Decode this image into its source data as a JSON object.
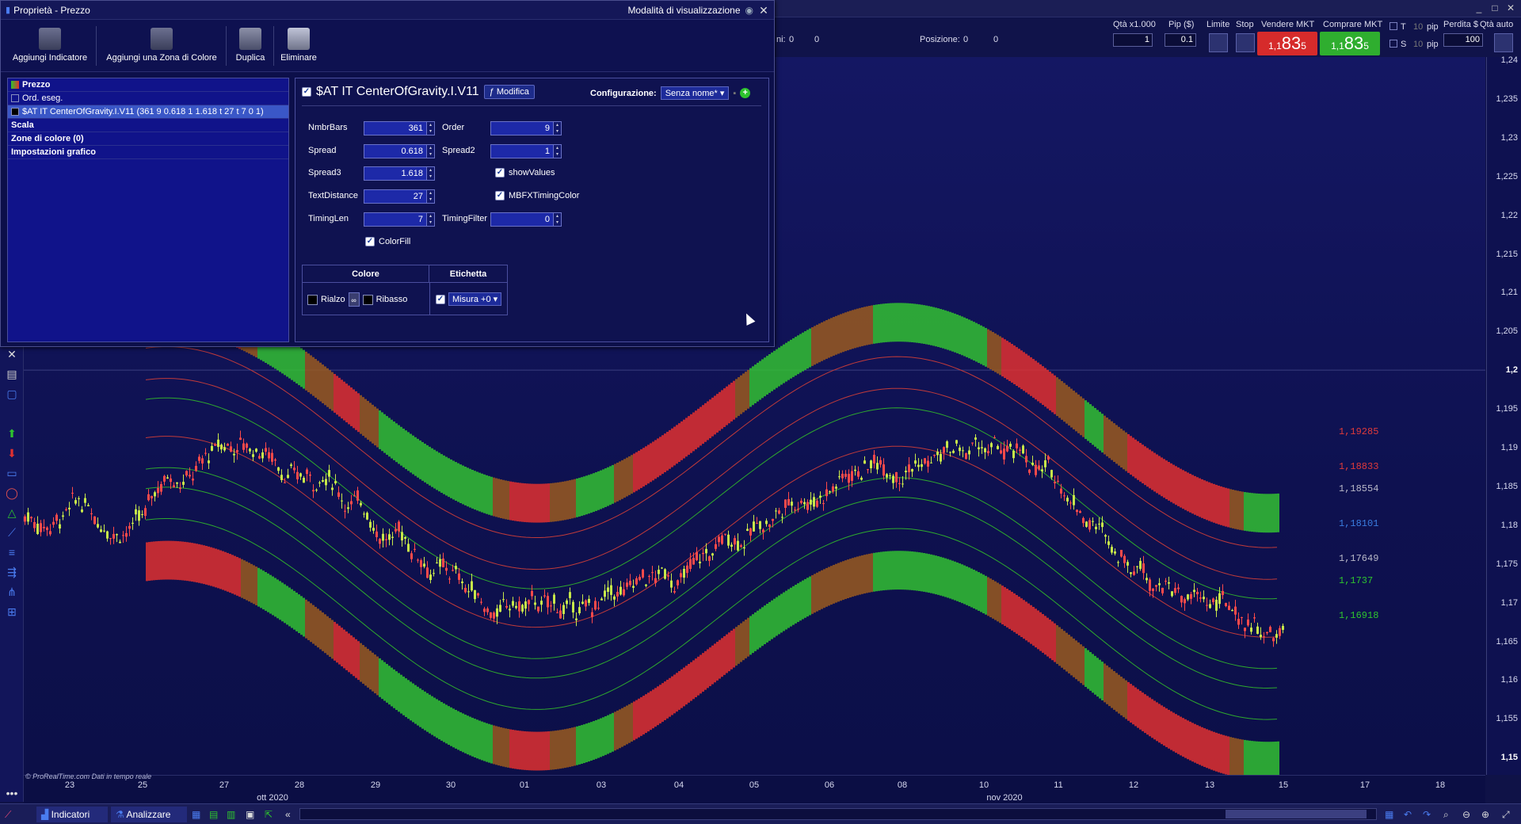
{
  "dialog": {
    "title": "Proprietà - Prezzo",
    "view_mode": "Modalità di visualizzazione",
    "toolbar": [
      {
        "label": "Aggiungi Indicatore",
        "icon": "add-indicator-icon"
      },
      {
        "label": "Aggiungi una Zona di Colore",
        "icon": "add-color-zone-icon"
      },
      {
        "label": "Duplica",
        "icon": "duplicate-icon"
      },
      {
        "label": "Eliminare",
        "icon": "trash-icon"
      }
    ],
    "tree": [
      {
        "label": "Prezzo",
        "bold": true
      },
      {
        "label": "Ord. eseg.",
        "bold": false
      },
      {
        "label": "$AT IT CenterOfGravity.I.V11 (361 9 0.618 1 1.618 t 27 t 7 0 1)",
        "selected": true
      },
      {
        "label": "Scala",
        "bold": true
      },
      {
        "label": "Zone di colore (0)",
        "bold": true
      },
      {
        "label": "Impostazioni grafico",
        "bold": true
      }
    ],
    "indicator_name": "$AT IT CenterOfGravity.I.V11",
    "modify_label": "Modifica",
    "config_label": "Configurazione:",
    "config_value": "Senza nome*",
    "params": {
      "NmbrBars": {
        "label": "NmbrBars",
        "value": "361"
      },
      "Order": {
        "label": "Order",
        "value": "9"
      },
      "Spread": {
        "label": "Spread",
        "value": "0.618"
      },
      "Spread2": {
        "label": "Spread2",
        "value": "1"
      },
      "Spread3": {
        "label": "Spread3",
        "value": "1.618"
      },
      "showValues": {
        "label": "showValues",
        "checked": true
      },
      "TextDistance": {
        "label": "TextDistance",
        "value": "27"
      },
      "MBFXTimingColor": {
        "label": "MBFXTimingColor",
        "checked": true
      },
      "TimingLen": {
        "label": "TimingLen",
        "value": "7"
      },
      "TimingFilter": {
        "label": "TimingFilter",
        "value": "0"
      },
      "ColorFill": {
        "label": "ColorFill",
        "checked": true
      }
    },
    "table": {
      "col_color": "Colore",
      "col_label": "Etichetta",
      "rise": "Rialzo",
      "fall": "Ribasso",
      "measure": "Misura +0"
    }
  },
  "trade": {
    "qty_label": "Qtà x1.000",
    "qty_value": "1",
    "pip_label": "Pip ($)",
    "pip_value": "0.1",
    "limit_label": "Limite",
    "stop_label": "Stop",
    "sell_label": "Vendere MKT",
    "buy_label": "Comprare MKT",
    "sell_big": "83",
    "sell_small": "1,1",
    "sell_sup": "5",
    "buy_big": "83",
    "buy_small": "1,1",
    "buy_sup": "5",
    "t_label": "T",
    "s_label": "S",
    "pip1": "pip",
    "pip2": "pip",
    "ts_value1": "10",
    "ts_value2": "10",
    "loss_label": "Perdita $",
    "loss_value": "100",
    "auto_label": "Qtà auto",
    "ordini_label": "ni:",
    "ordini_a": "0",
    "ordini_b": "0",
    "pos_label": "Posizione:",
    "pos_value": "0",
    "pos_value2": "0"
  },
  "chart": {
    "y_ticks": [
      "1,24",
      "1,235",
      "1,23",
      "1,225",
      "1,22",
      "1,215",
      "1,21",
      "1,205",
      "1,2",
      "1,195",
      "1,19",
      "1,185",
      "1,18",
      "1,175",
      "1,17",
      "1,165",
      "1,16",
      "1,155",
      "1,15"
    ],
    "x_ticks": [
      "23",
      "25",
      "27",
      "28",
      "29",
      "30",
      "01",
      "03",
      "04",
      "05",
      "06",
      "08",
      "10",
      "11",
      "12",
      "13",
      "15",
      "17",
      "18"
    ],
    "x_months": [
      "ott 2020",
      "nov 2020"
    ],
    "credit": "© ProRealTime.com  Dati in tempo reale",
    "levels": [
      {
        "value": "1,19285",
        "color": "#e03a3a"
      },
      {
        "value": "1,18833",
        "color": "#e03a3a"
      },
      {
        "value": "1,18554",
        "color": "#b8b8c8"
      },
      {
        "value": "1,18101",
        "color": "#3a7de0"
      },
      {
        "value": "1,17649",
        "color": "#b8b8c8"
      },
      {
        "value": "1,1737",
        "color": "#2ec42e"
      },
      {
        "value": "1,16918",
        "color": "#2ec42e"
      }
    ]
  },
  "bottom": {
    "indicators_label": "Indicatori",
    "analyze_label": "Analizzare"
  },
  "chart_data": {
    "type": "line",
    "y_range": [
      1.15,
      1.24
    ],
    "center_levels": [
      1.19285,
      1.18833,
      1.18554,
      1.18101,
      1.17649,
      1.1737,
      1.16918
    ]
  }
}
